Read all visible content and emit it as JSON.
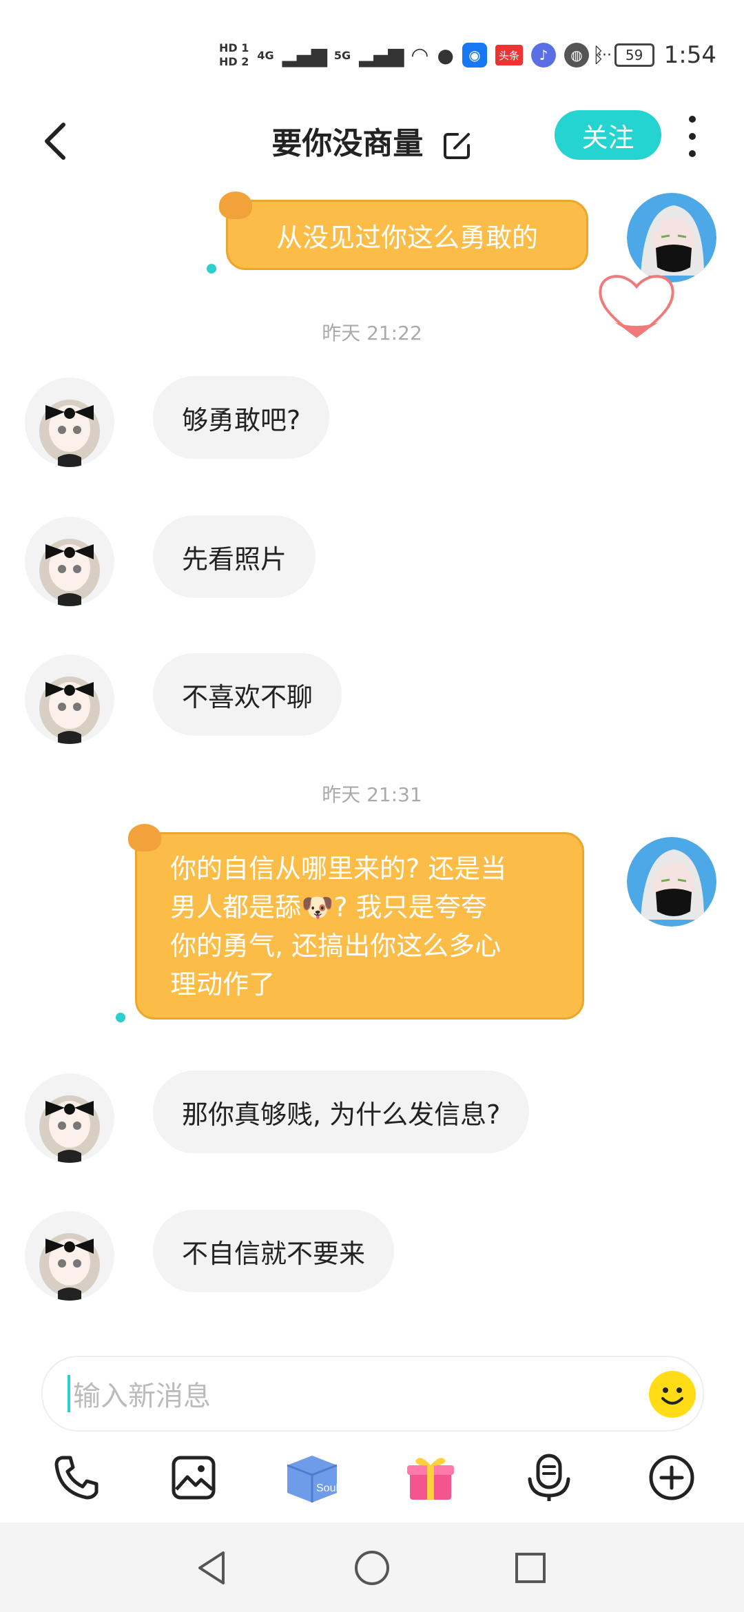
{
  "status_bar": {
    "hd1": "HD 1",
    "hd2": "HD 2",
    "net1": "4G",
    "net2": "5G",
    "app_toutiao": "头条",
    "more": "···",
    "battery": "59",
    "time": "1:54"
  },
  "header": {
    "title": "要你没商量",
    "follow_label": "关注"
  },
  "messages": [
    {
      "side": "right",
      "text": "从没见过你这么勇敢的"
    },
    {
      "side": "timestamp",
      "text": "昨天 21:22"
    },
    {
      "side": "left",
      "text": "够勇敢吧?"
    },
    {
      "side": "left",
      "text": "先看照片"
    },
    {
      "side": "left",
      "text": "不喜欢不聊"
    },
    {
      "side": "timestamp",
      "text": "昨天 21:31"
    },
    {
      "side": "right",
      "lines": [
        "你的自信从哪里来的? 还是当",
        "男人都是舔🐶? 我只是夸夸",
        "你的勇气, 还搞出你这么多心",
        "理动作了"
      ]
    },
    {
      "side": "left",
      "text": "那你真够贱, 为什么发信息?"
    },
    {
      "side": "left",
      "text": "不自信就不要来"
    }
  ],
  "input": {
    "placeholder": "输入新消息"
  },
  "toolbar": {
    "soul_label": "Soul",
    "icons": [
      "phone-icon",
      "image-icon",
      "soul-box-icon",
      "gift-icon",
      "voice-icon",
      "plus-icon"
    ]
  }
}
